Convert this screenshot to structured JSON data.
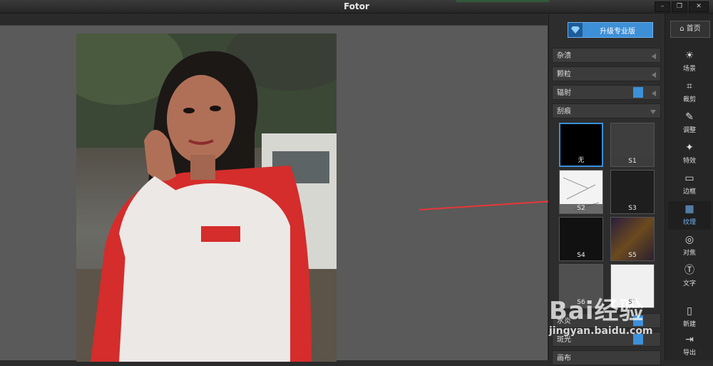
{
  "app": {
    "title": "Fotor"
  },
  "window_buttons": {
    "minimize": "–",
    "restore": "❐",
    "close": "✕"
  },
  "panel": {
    "upgrade_label": "升级专业版",
    "sections": [
      {
        "label": "杂溃"
      },
      {
        "label": "颗粒"
      },
      {
        "label": "辐射"
      },
      {
        "label": "刮痕"
      }
    ],
    "textures": [
      {
        "label": "无",
        "selected": true
      },
      {
        "label": "S1"
      },
      {
        "label": "S2"
      },
      {
        "label": "S3"
      },
      {
        "label": "S4"
      },
      {
        "label": "S5"
      },
      {
        "label": "S6"
      },
      {
        "label": "S7"
      }
    ],
    "more_sections": [
      {
        "label": "水炎"
      },
      {
        "label": "斑光"
      },
      {
        "label": "画布"
      }
    ]
  },
  "toolbar": {
    "home_label": "首页",
    "tools": [
      {
        "label": "场景",
        "icon": "sun-icon"
      },
      {
        "label": "裁剪",
        "icon": "crop-icon"
      },
      {
        "label": "调整",
        "icon": "pencil-icon"
      },
      {
        "label": "特效",
        "icon": "sparkle-icon"
      },
      {
        "label": "边框",
        "icon": "frame-icon"
      },
      {
        "label": "纹理",
        "icon": "texture-icon",
        "active": true
      },
      {
        "label": "对焦",
        "icon": "target-icon"
      },
      {
        "label": "文字",
        "icon": "text-icon"
      },
      {
        "label": "新建",
        "icon": "new-file-icon"
      },
      {
        "label": "导出",
        "icon": "export-icon"
      }
    ]
  },
  "watermark": {
    "brand": "Bai经验",
    "url": "jingyan.baidu.com"
  },
  "colors": {
    "accent": "#3d8fd8",
    "arrow": "#e8363a"
  }
}
